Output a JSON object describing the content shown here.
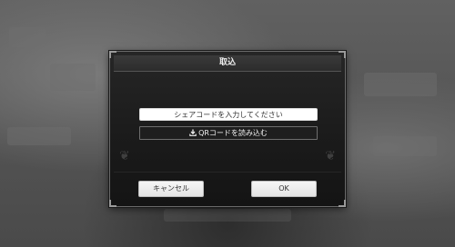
{
  "dialog": {
    "title": "取込",
    "share_code_input": {
      "value": "",
      "placeholder": "シェアコードを入力してください"
    },
    "qr_button_label": "QRコードを読み込む",
    "cancel_label": "キャンセル",
    "ok_label": "OK"
  },
  "icons": {
    "qr_button": "download-icon"
  },
  "colors": {
    "dialog_background": "#1b1b1b",
    "dialog_border": "#6a6a6a",
    "input_background": "#ffffff",
    "button_background": "#f0f0f0",
    "overlay_background": "#5a5a5a"
  }
}
